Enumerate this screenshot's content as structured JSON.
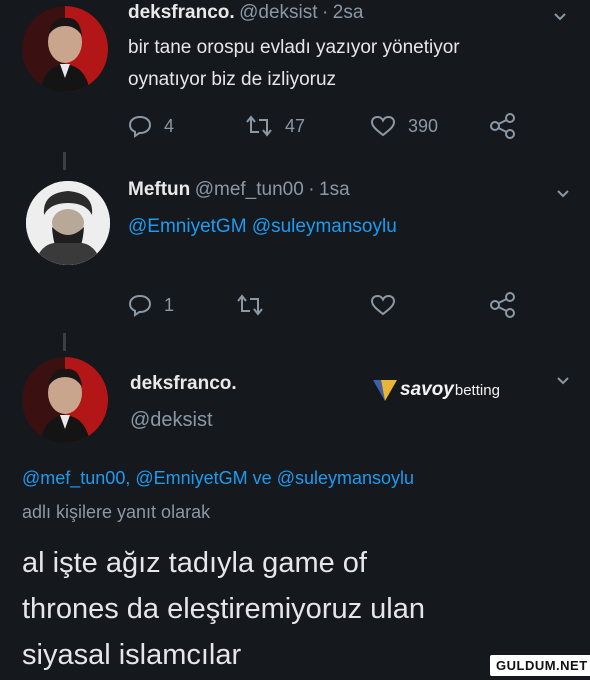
{
  "tweets": [
    {
      "name": "deksfranco.",
      "handle": "@deksist",
      "sep": "·",
      "time": "2sa",
      "text_line1": "bir tane orospu evladı yazıyor yönetiyor",
      "text_line2": "oynatıyor biz de izliyoruz",
      "replies": "4",
      "retweets": "47",
      "likes": "390"
    },
    {
      "name": "Meftun",
      "handle": "@mef_tun00",
      "sep": "·",
      "time": "1sa",
      "text_mention1": "@EmniyetGM",
      "text_mention2": "@suleymansoylu",
      "replies": "1"
    },
    {
      "name": "deksfranco.",
      "handle": "@deksist",
      "reply_to_m1": "@mef_tun00,",
      "reply_to_m2": "@EmniyetGM",
      "reply_to_ve": "ve",
      "reply_to_m3": "@suleymansoylu",
      "reply_suffix": "adlı kişilere yanıt olarak",
      "text_line1": "al işte ağız tadıyla game of",
      "text_line2": "thrones da eleştiremiyoruz ulan",
      "text_line3": "siyasal islamcılar"
    }
  ],
  "watermarks": {
    "savoy_main": "savoy",
    "savoy_sub": "betting",
    "site": "GULDUM.NET"
  },
  "colors": {
    "background": "#15181c",
    "link": "#1d9bf0",
    "muted": "#8b98a5"
  },
  "icons": [
    "reply-icon",
    "retweet-icon",
    "heart-icon",
    "share-icon",
    "chevron-down-icon"
  ]
}
